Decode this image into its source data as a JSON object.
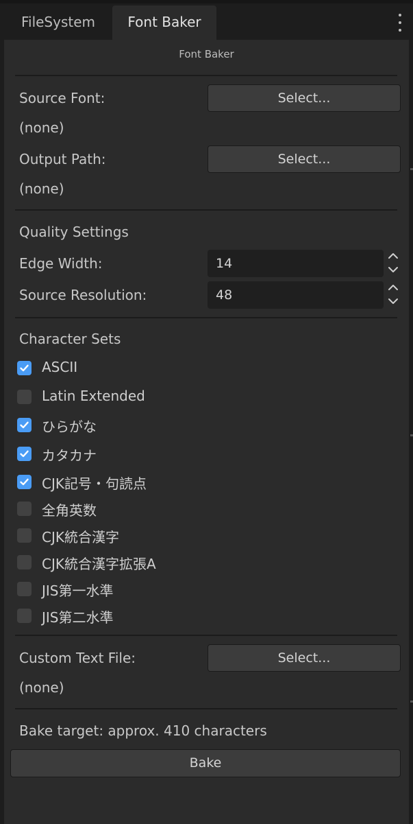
{
  "tabs": [
    {
      "label": "FileSystem",
      "active": false
    },
    {
      "label": "Font Baker",
      "active": true
    }
  ],
  "menu_icon": "vertical-dots-icon",
  "panel": {
    "title": "Font Baker",
    "source_font": {
      "label": "Source Font:",
      "button": "Select...",
      "value": "(none)"
    },
    "output_path": {
      "label": "Output Path:",
      "button": "Select...",
      "value": "(none)"
    },
    "quality": {
      "heading": "Quality Settings",
      "edge_width": {
        "label": "Edge Width:",
        "value": "14"
      },
      "source_resolution": {
        "label": "Source Resolution:",
        "value": "48"
      }
    },
    "character_sets": {
      "heading": "Character Sets",
      "items": [
        {
          "label": "ASCII",
          "checked": true
        },
        {
          "label": "Latin Extended",
          "checked": false
        },
        {
          "label": "ひらがな",
          "checked": true
        },
        {
          "label": "カタカナ",
          "checked": true
        },
        {
          "label": "CJK記号・句読点",
          "checked": true
        },
        {
          "label": "全角英数",
          "checked": false
        },
        {
          "label": "CJK統合漢字",
          "checked": false
        },
        {
          "label": "CJK統合漢字拡張A",
          "checked": false
        },
        {
          "label": "JIS第一水準",
          "checked": false
        },
        {
          "label": "JIS第二水準",
          "checked": false
        }
      ]
    },
    "custom_text_file": {
      "label": "Custom Text File:",
      "button": "Select...",
      "value": "(none)"
    },
    "bake_target": "Bake target: approx. 410 characters",
    "bake_button": "Bake"
  },
  "colors": {
    "accent_checkbox": "#4a9cf5",
    "panel_bg": "#2b2b2b",
    "window_bg": "#1d1d1d"
  }
}
